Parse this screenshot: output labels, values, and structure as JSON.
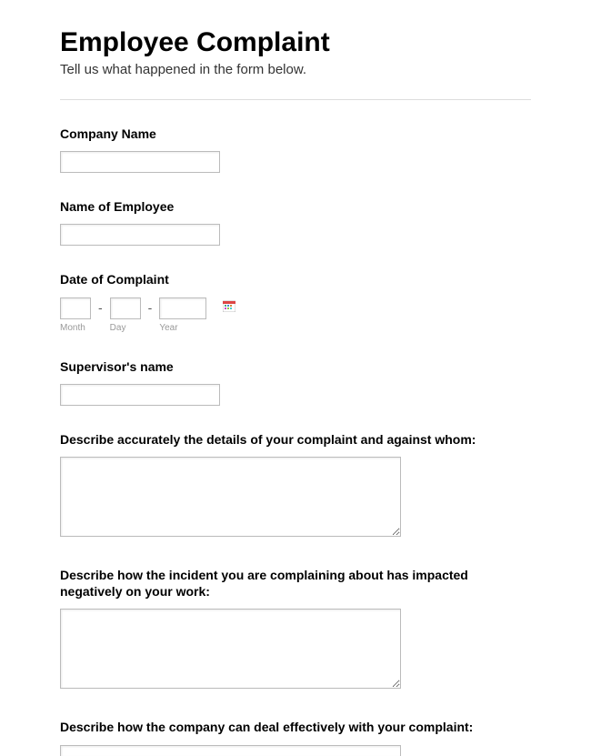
{
  "header": {
    "title": "Employee Complaint",
    "subtitle": "Tell us what happened in the form below."
  },
  "fields": {
    "company_name": {
      "label": "Company Name",
      "value": ""
    },
    "employee_name": {
      "label": "Name of Employee",
      "value": ""
    },
    "complaint_date": {
      "label": "Date of Complaint",
      "month": {
        "label": "Month",
        "value": ""
      },
      "day": {
        "label": "Day",
        "value": ""
      },
      "year": {
        "label": "Year",
        "value": ""
      },
      "separator": "-"
    },
    "supervisor_name": {
      "label": "Supervisor's name",
      "value": ""
    },
    "complaint_details": {
      "label": "Describe accurately the details of your complaint and against whom:",
      "value": ""
    },
    "incident_impact": {
      "label": "Describe how the incident you are complaining about has impacted negatively on your work:",
      "value": ""
    },
    "company_response": {
      "label": "Describe how the company can deal effectively with your complaint:",
      "value": ""
    }
  }
}
